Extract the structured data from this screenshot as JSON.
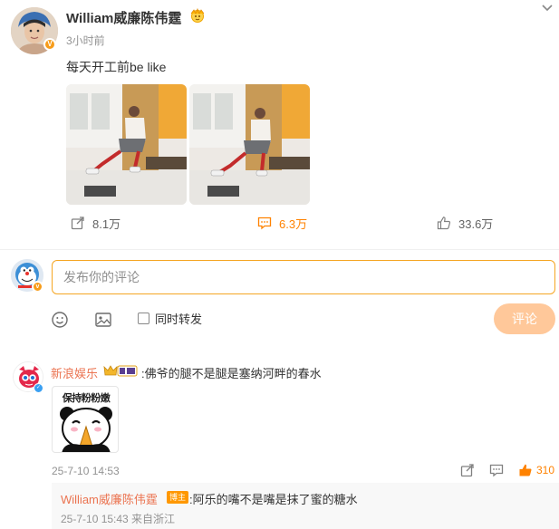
{
  "post": {
    "author": "William威廉陈伟霆",
    "time": "3小时前",
    "text": "每天开工前be like",
    "repost_count": "8.1万",
    "comment_count": "6.3万",
    "like_count": "33.6万"
  },
  "composer": {
    "placeholder": "发布你的评论",
    "repost_label": "同时转发",
    "submit_label": "评论"
  },
  "comment": {
    "author": "新浪娱乐",
    "text": ":佛爷的腿不是腿是塞纳河畔的春水",
    "sticker_caption": "保持粉粉嫩",
    "time": "25-7-10 14:53",
    "like_count": "310"
  },
  "reply": {
    "author": "William威廉陈伟霆",
    "author_tag": "博主",
    "text": ":阿乐的嘴不是嘴是抹了蜜的糖水",
    "time": "25-7-10 15:43 来自浙江"
  },
  "colors": {
    "accent": "#ff8200",
    "name_link": "#eb7350",
    "submit_disabled": "#ffc89a",
    "input_border": "#f5a623"
  },
  "icons": [
    "chevron-down-icon",
    "repost-icon",
    "comment-icon",
    "like-icon",
    "emoji-icon",
    "image-icon",
    "share-icon",
    "reply-icon"
  ]
}
